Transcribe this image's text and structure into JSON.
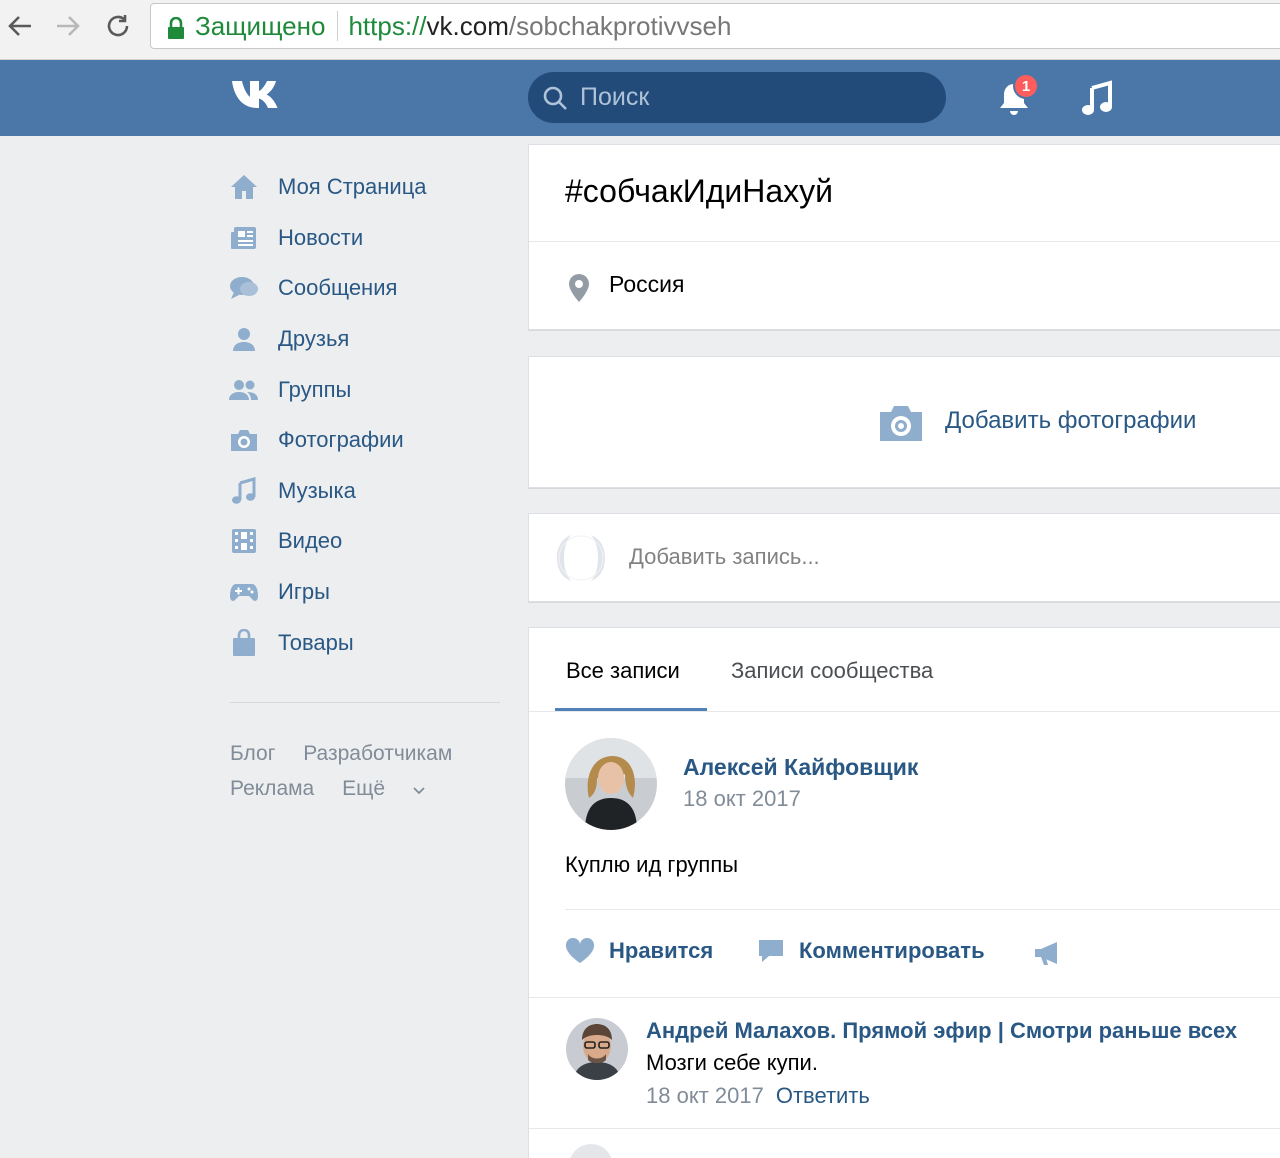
{
  "browser": {
    "secure_label": "Защищено",
    "url_scheme": "https://",
    "url_host": "vk.com",
    "url_path": "/sobchakprotivvseh"
  },
  "header": {
    "search_placeholder": "Поиск",
    "notifications_count": "1"
  },
  "sidebar": {
    "items": [
      {
        "label": "Моя Страница",
        "icon": "home-icon"
      },
      {
        "label": "Новости",
        "icon": "news-icon"
      },
      {
        "label": "Сообщения",
        "icon": "messages-icon"
      },
      {
        "label": "Друзья",
        "icon": "friend-icon"
      },
      {
        "label": "Группы",
        "icon": "groups-icon"
      },
      {
        "label": "Фотографии",
        "icon": "camera-icon"
      },
      {
        "label": "Музыка",
        "icon": "music-icon"
      },
      {
        "label": "Видео",
        "icon": "video-icon"
      },
      {
        "label": "Игры",
        "icon": "gamepad-icon"
      },
      {
        "label": "Товары",
        "icon": "bag-icon"
      }
    ],
    "footer": {
      "blog": "Блог",
      "developers": "Разработчикам",
      "ads": "Реклама",
      "more": "Ещё"
    }
  },
  "group": {
    "title": "#собчакИдиНахуй",
    "location": "Россия",
    "add_photos": "Добавить фотографии",
    "add_post_placeholder": "Добавить запись..."
  },
  "wall": {
    "tabs": [
      {
        "label": "Все записи",
        "active": true
      },
      {
        "label": "Записи сообщества",
        "active": false
      }
    ],
    "post": {
      "author": "Алексей Кайфовщик",
      "date": "18 окт 2017",
      "text": "Куплю ид группы",
      "like_label": "Нравится",
      "comment_label": "Комментировать"
    },
    "comment": {
      "author": "Андрей Малахов. Прямой эфир | Смотри раньше всех",
      "text": "Мозги себе купи.",
      "date": "18 окт 2017",
      "reply_label": "Ответить"
    }
  },
  "colors": {
    "brand": "#4a76a8",
    "link": "#2a5885",
    "badge": "#ff5c5c",
    "secure_green": "#1e8a3a"
  }
}
